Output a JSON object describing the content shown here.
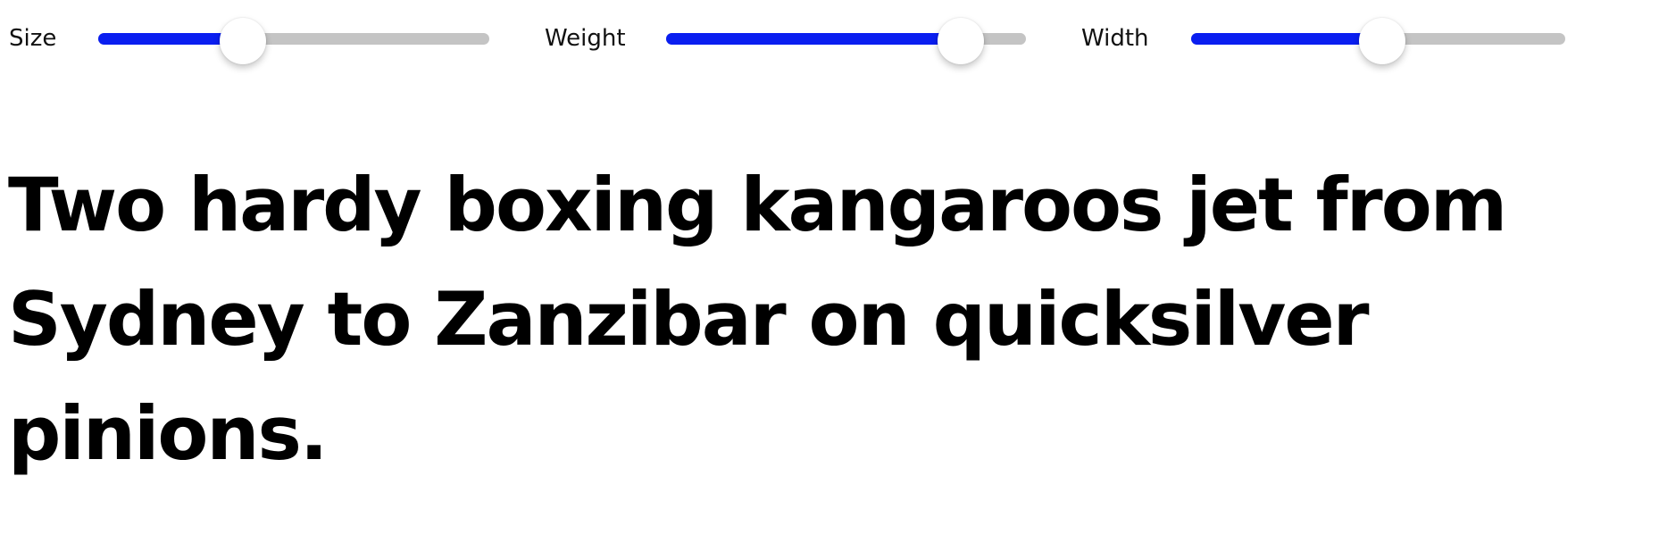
{
  "controls": {
    "size": {
      "label": "Size",
      "value": 0.37
    },
    "weight": {
      "label": "Weight",
      "value": 0.82
    },
    "width": {
      "label": "Width",
      "value": 0.51
    }
  },
  "colors": {
    "slider_fill": "#0a1ef0",
    "slider_track": "#c4c4c4",
    "thumb": "#ffffff",
    "text": "#000000",
    "background": "#ffffff"
  },
  "specimen": {
    "text": "Two hardy boxing kangaroos jet from Sydney to Zanzibar on quicksilver pinions."
  }
}
